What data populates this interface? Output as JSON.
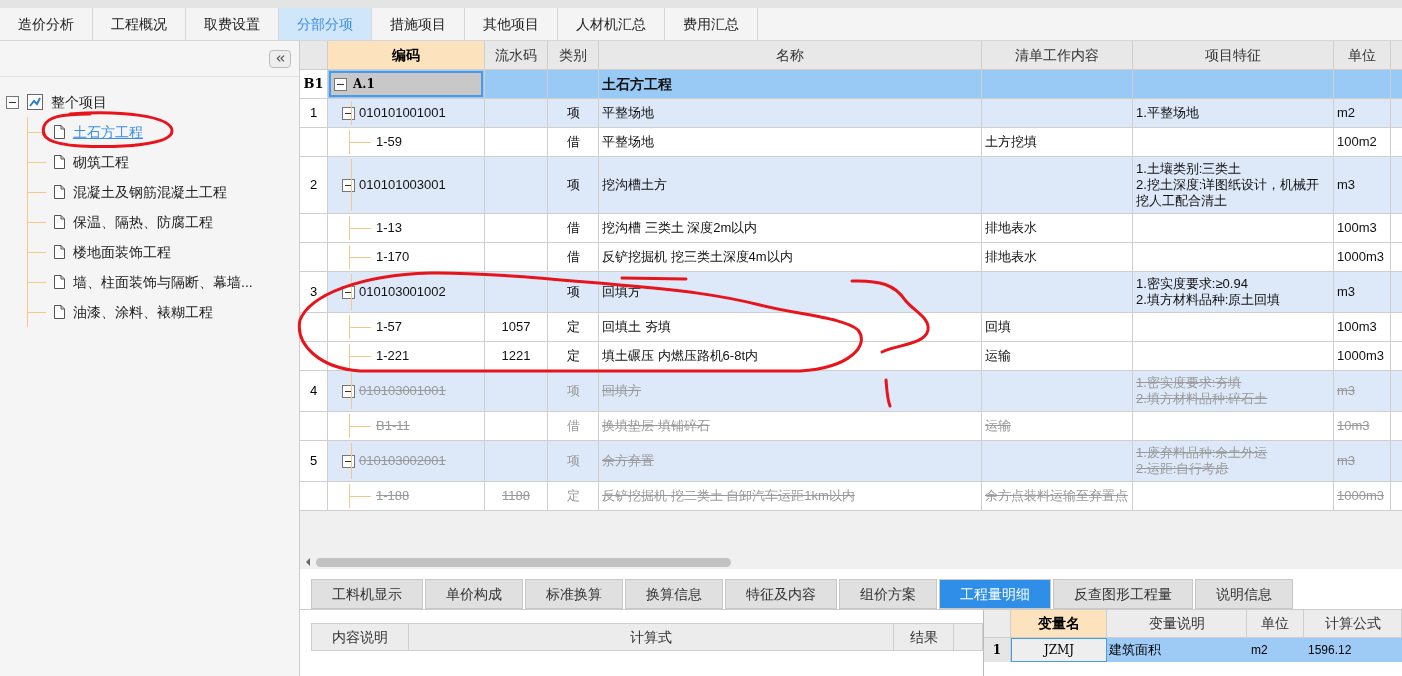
{
  "top_tabs": [
    {
      "label": "造价分析",
      "selected": false
    },
    {
      "label": "工程概况",
      "selected": false
    },
    {
      "label": "取费设置",
      "selected": false
    },
    {
      "label": "分部分项",
      "selected": true
    },
    {
      "label": "措施项目",
      "selected": false
    },
    {
      "label": "其他项目",
      "selected": false
    },
    {
      "label": "人材机汇总",
      "selected": false
    },
    {
      "label": "费用汇总",
      "selected": false
    }
  ],
  "sidebar": {
    "tree": {
      "label": "整个项目",
      "expanded": true,
      "children": [
        {
          "label": "土石方工程",
          "selected": true
        },
        {
          "label": "砌筑工程",
          "selected": false
        },
        {
          "label": "混凝土及钢筋混凝土工程",
          "selected": false
        },
        {
          "label": "保温、隔热、防腐工程",
          "selected": false
        },
        {
          "label": "楼地面装饰工程",
          "selected": false
        },
        {
          "label": "墙、柱面装饰与隔断、幕墙...",
          "selected": false
        },
        {
          "label": "油漆、涂料、裱糊工程",
          "selected": false
        }
      ]
    }
  },
  "table": {
    "columns": [
      {
        "label": "编码",
        "selected": true
      },
      {
        "label": "流水码",
        "selected": false
      },
      {
        "label": "类别",
        "selected": false
      },
      {
        "label": "名称",
        "selected": false
      },
      {
        "label": "清单工作内容",
        "selected": false
      },
      {
        "label": "项目特征",
        "selected": false
      },
      {
        "label": "单位",
        "selected": false
      }
    ],
    "rows": [
      {
        "kind": "section",
        "no": "B1",
        "code": "A.1",
        "name": "土石方工程",
        "expanded": true,
        "selected": true,
        "deleted": false
      },
      {
        "kind": "item",
        "no": "1",
        "code": "010101001001",
        "type": "项",
        "name": "平整场地",
        "features": [
          "1.平整场地"
        ],
        "unit": "m2",
        "expanded": true,
        "selected": false,
        "deleted": false
      },
      {
        "kind": "sub",
        "code": "1-59",
        "type": "借",
        "name": "平整场地",
        "content": "土方挖填",
        "unit": "100m2",
        "selected": false,
        "deleted": false
      },
      {
        "kind": "item",
        "no": "2",
        "code": "010101003001",
        "type": "项",
        "name": "挖沟槽土方",
        "features": [
          "1.土壤类别:三类土",
          "2.挖土深度:详图纸设计，机械开挖人工配合清土"
        ],
        "unit": "m3",
        "expanded": true,
        "selected": false,
        "deleted": false
      },
      {
        "kind": "sub",
        "code": "1-13",
        "type": "借",
        "name": "挖沟槽 三类土 深度2m以内",
        "content": "排地表水",
        "unit": "100m3",
        "selected": false,
        "deleted": false
      },
      {
        "kind": "sub",
        "code": "1-170",
        "type": "借",
        "name": "反铲挖掘机 挖三类土深度4m以内",
        "content": "排地表水",
        "unit": "1000m3",
        "selected": false,
        "deleted": false
      },
      {
        "kind": "item",
        "no": "3",
        "code": "010103001002",
        "type": "项",
        "name": "回填方",
        "features": [
          "1.密实度要求:≥0.94",
          "2.填方材料品种:原土回填"
        ],
        "unit": "m3",
        "expanded": true,
        "selected": false,
        "deleted": false
      },
      {
        "kind": "sub",
        "code": "1-57",
        "serial": "1057",
        "type": "定",
        "name": "回填土 夯填",
        "content": "回填",
        "unit": "100m3",
        "selected": false,
        "deleted": false
      },
      {
        "kind": "sub",
        "code": "1-221",
        "serial": "1221",
        "type": "定",
        "name": "填土碾压 内燃压路机6-8t内",
        "content": "运输",
        "unit": "1000m3",
        "selected": false,
        "deleted": false
      },
      {
        "kind": "item",
        "no": "4",
        "code": "010103001001",
        "type": "项",
        "name": "回填方",
        "features": [
          "1.密实度要求:夯填",
          "2.填方材料品种:碎石土"
        ],
        "unit": "m3",
        "expanded": true,
        "selected": false,
        "deleted": true
      },
      {
        "kind": "sub",
        "code": "B1-11",
        "type": "借",
        "name": "换填垫层 填铺碎石",
        "content": "运输",
        "unit": "10m3",
        "selected": false,
        "deleted": true
      },
      {
        "kind": "item",
        "no": "5",
        "code": "010103002001",
        "type": "项",
        "name": "余方弃置",
        "features": [
          "1.废弃料品种:余土外运",
          "2.运距:自行考虑"
        ],
        "unit": "m3",
        "expanded": true,
        "selected": false,
        "deleted": true
      },
      {
        "kind": "sub",
        "code": "1-188",
        "serial": "1188",
        "type": "定",
        "name": "反铲挖掘机 挖二类土 自卸汽车运距1km以内",
        "content": "余方点装料运输至弃置点",
        "unit": "1000m3",
        "selected": false,
        "deleted": true
      }
    ]
  },
  "bottom_tabs": [
    {
      "label": "工料机显示",
      "selected": false
    },
    {
      "label": "单价构成",
      "selected": false
    },
    {
      "label": "标准换算",
      "selected": false
    },
    {
      "label": "换算信息",
      "selected": false
    },
    {
      "label": "特征及内容",
      "selected": false
    },
    {
      "label": "组价方案",
      "selected": false
    },
    {
      "label": "工程量明细",
      "selected": true
    },
    {
      "label": "反查图形工程量",
      "selected": false
    },
    {
      "label": "说明信息",
      "selected": false
    }
  ],
  "detail_table": {
    "columns": [
      "内容说明",
      "计算式",
      "结果"
    ]
  },
  "variable_table": {
    "columns": [
      {
        "label": "变量名",
        "selected": true
      },
      {
        "label": "变量说明",
        "selected": false
      },
      {
        "label": "单位",
        "selected": false
      },
      {
        "label": "计算公式",
        "selected": false
      }
    ],
    "rows": [
      {
        "no": "1",
        "name": "JZMJ",
        "description": "建筑面积",
        "unit": "m2",
        "formula": "1596.12",
        "selected": true
      }
    ]
  }
}
